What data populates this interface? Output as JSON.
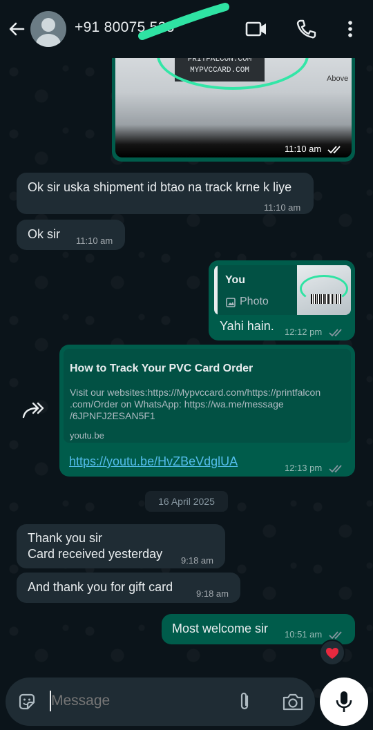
{
  "header": {
    "contact_name": "+91 80075  523"
  },
  "messages": {
    "image_time": "11:10 am",
    "image_label_line1": "PRITFALCON.COM",
    "image_label_line2": "MYPVCCARD.COM",
    "image_side_text": "Above",
    "m1_text": "Ok sir uska shipment id btao na track krne k liye",
    "m1_time": "11:10 am",
    "m2_text": "Ok sir",
    "m2_time": "11:10 am",
    "reply_author": "You",
    "reply_type": "Photo",
    "m3_text": "Yahi hain.",
    "m3_time": "12:12 pm",
    "link_title": "How to Track Your PVC Card Order",
    "link_desc_1": "Visit our websites:https://Mypvccard.com/https://printfalcon",
    "link_desc_2": ".com/Order on WhatsApp: https://wa.me/message",
    "link_desc_3": "/6JPNFJ2ESAN5F1",
    "link_domain": "youtu.be",
    "link_url": "https://youtu.be/HvZBeVdglUA",
    "m4_time": "12:13 pm",
    "date_chip": "16 April 2025",
    "m5_line1": "Thank you sir",
    "m5_line2": "Card received yesterday",
    "m5_time": "9:18 am",
    "m6_text": "And thank you for gift card",
    "m6_time": "9:18 am",
    "m7_text": "Most welcome sir",
    "m7_time": "10:51 am",
    "reaction": "❤️"
  },
  "composer": {
    "placeholder": "Message"
  },
  "colors": {
    "background": "#0b141a",
    "incoming_bubble": "#1f2c34",
    "outgoing_bubble": "#005c4b",
    "link_blue": "#53bdeb",
    "tick_gray": "#8696a0"
  }
}
